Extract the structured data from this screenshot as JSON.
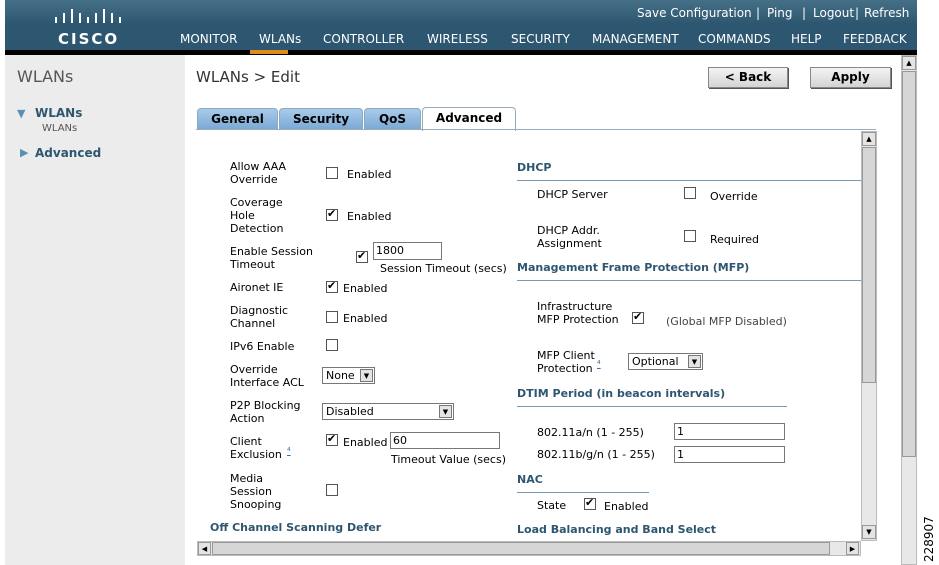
{
  "brand": {
    "name": "CISCO",
    "header_color": "#2d5670",
    "accent_color": "#e08a1a"
  },
  "toplinks": [
    "Save Configuration",
    "Ping",
    "Logout",
    "Refresh"
  ],
  "nav": [
    "MONITOR",
    "WLANs",
    "CONTROLLER",
    "WIRELESS",
    "SECURITY",
    "MANAGEMENT",
    "COMMANDS",
    "HELP",
    "FEEDBACK"
  ],
  "sidebar": {
    "title": "WLANs",
    "items": [
      {
        "label": "WLANs",
        "sub": "WLANs"
      },
      {
        "label": "Advanced"
      }
    ]
  },
  "page": {
    "title": "WLANs > Edit",
    "back_label": "< Back",
    "apply_label": "Apply"
  },
  "tabs": [
    "General",
    "Security",
    "QoS",
    "Advanced"
  ],
  "active_tab": "Advanced",
  "left": {
    "allow_aaa": {
      "label": "Allow AAA Override",
      "checked": false,
      "text": "Enabled"
    },
    "coverage_hole": {
      "label": "Coverage Hole Detection",
      "checked": true,
      "text": "Enabled"
    },
    "session_timeout": {
      "label": "Enable Session Timeout",
      "checked": true,
      "value": "1800",
      "caption": "Session Timeout (secs)"
    },
    "aironet_ie": {
      "label": "Aironet IE",
      "checked": true,
      "text": "Enabled"
    },
    "diagnostic": {
      "label": "Diagnostic Channel",
      "checked": false,
      "text": "Enabled"
    },
    "ipv6": {
      "label": "IPv6 Enable",
      "checked": false
    },
    "override_acl": {
      "label": "Override Interface ACL",
      "value": "None"
    },
    "p2p": {
      "label": "P2P Blocking Action",
      "value": "Disabled"
    },
    "client_exclusion": {
      "label": "Client Exclusion",
      "checked": true,
      "text": "Enabled",
      "value": "60",
      "caption": "Timeout Value (secs)"
    },
    "media_snooping": {
      "label": "Media Session Snooping",
      "checked": false
    },
    "off_channel": "Off Channel Scanning Defer"
  },
  "right": {
    "dhcp": {
      "title": "DHCP",
      "server_label": "DHCP Server",
      "server_checked": false,
      "server_text": "Override",
      "addr_label": "DHCP Addr. Assignment",
      "addr_checked": false,
      "addr_text": "Required"
    },
    "mfp": {
      "title": "Management Frame Protection (MFP)",
      "infra_label": "Infrastructure MFP Protection",
      "infra_checked": true,
      "infra_note": "(Global MFP Disabled)",
      "client_label": "MFP Client Protection",
      "client_value": "Optional"
    },
    "dtim": {
      "title": "DTIM Period (in beacon intervals)",
      "a_label": "802.11a/n (1 - 255)",
      "a_value": "1",
      "bg_label": "802.11b/g/n (1 - 255)",
      "bg_value": "1"
    },
    "nac": {
      "title": "NAC",
      "state_label": "State",
      "checked": true,
      "text": "Enabled"
    },
    "load_balancing": "Load Balancing and Band Select"
  },
  "figure_id": "228907"
}
